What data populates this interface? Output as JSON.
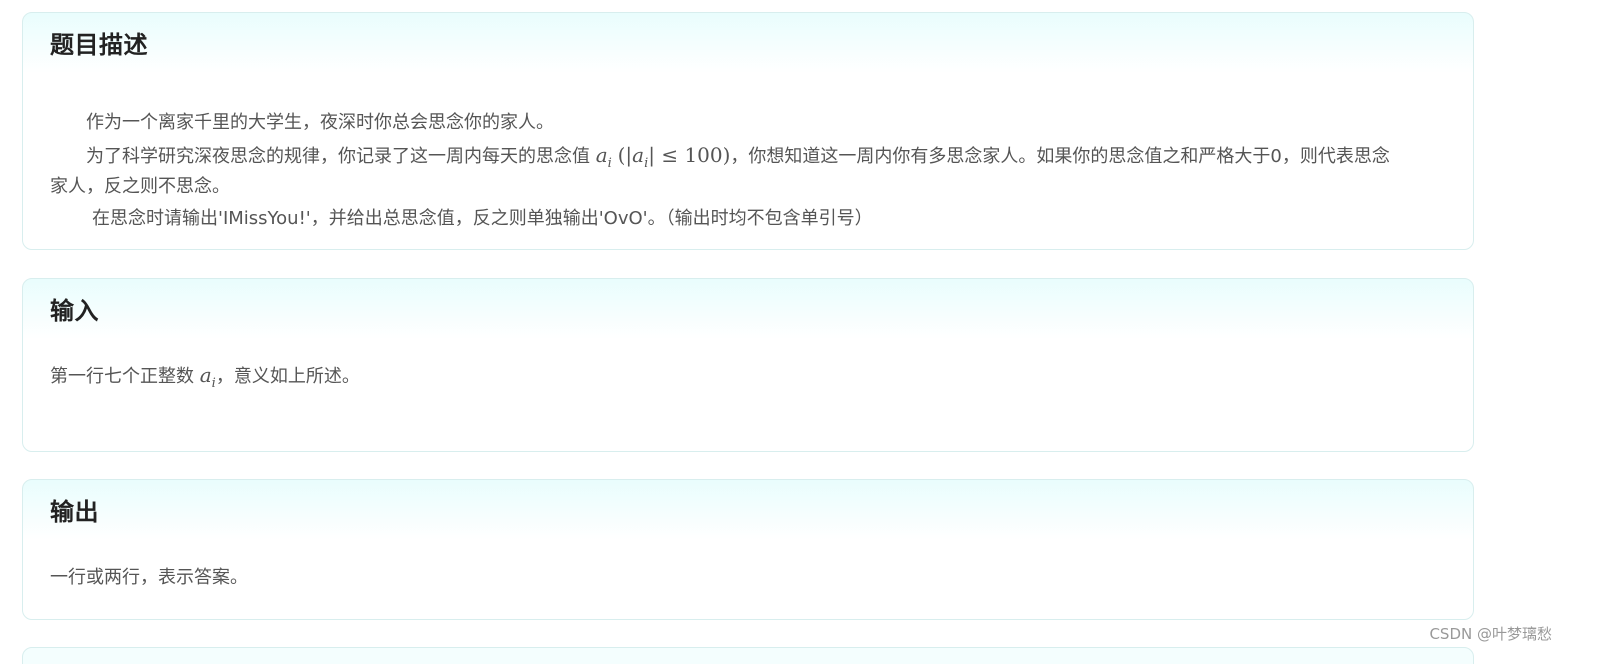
{
  "description": {
    "title": "题目描述",
    "line1": "作为一个离家千里的大学生，夜深时你总会思念你的家人。",
    "line2_pre": "为了科学研究深夜思念的规律，你记录了这一周内每天的思念值",
    "line2_var": "a",
    "line2_sub": "i",
    "line2_cond_open": "(|",
    "line2_cond_var": "a",
    "line2_cond_sub": "i",
    "line2_cond_close": "| ≤ 100)",
    "line2_post": "，你想知道这一周内你有多思念家人。如果你的思念值之和严格大于0，则代表思念",
    "line3": "家人，反之则不思念。",
    "line4": "在思念时请输出'IMissYou!'，并给出总思念值，反之则单独输出'OvO'。（输出时均不包含单引号）"
  },
  "input": {
    "title": "输入",
    "text_pre": "第一行七个正整数",
    "var": "a",
    "sub": "i",
    "text_post": "，意义如上所述。"
  },
  "output": {
    "title": "输出",
    "text": "一行或两行，表示答案。"
  },
  "watermark": "CSDN @叶梦璃愁"
}
